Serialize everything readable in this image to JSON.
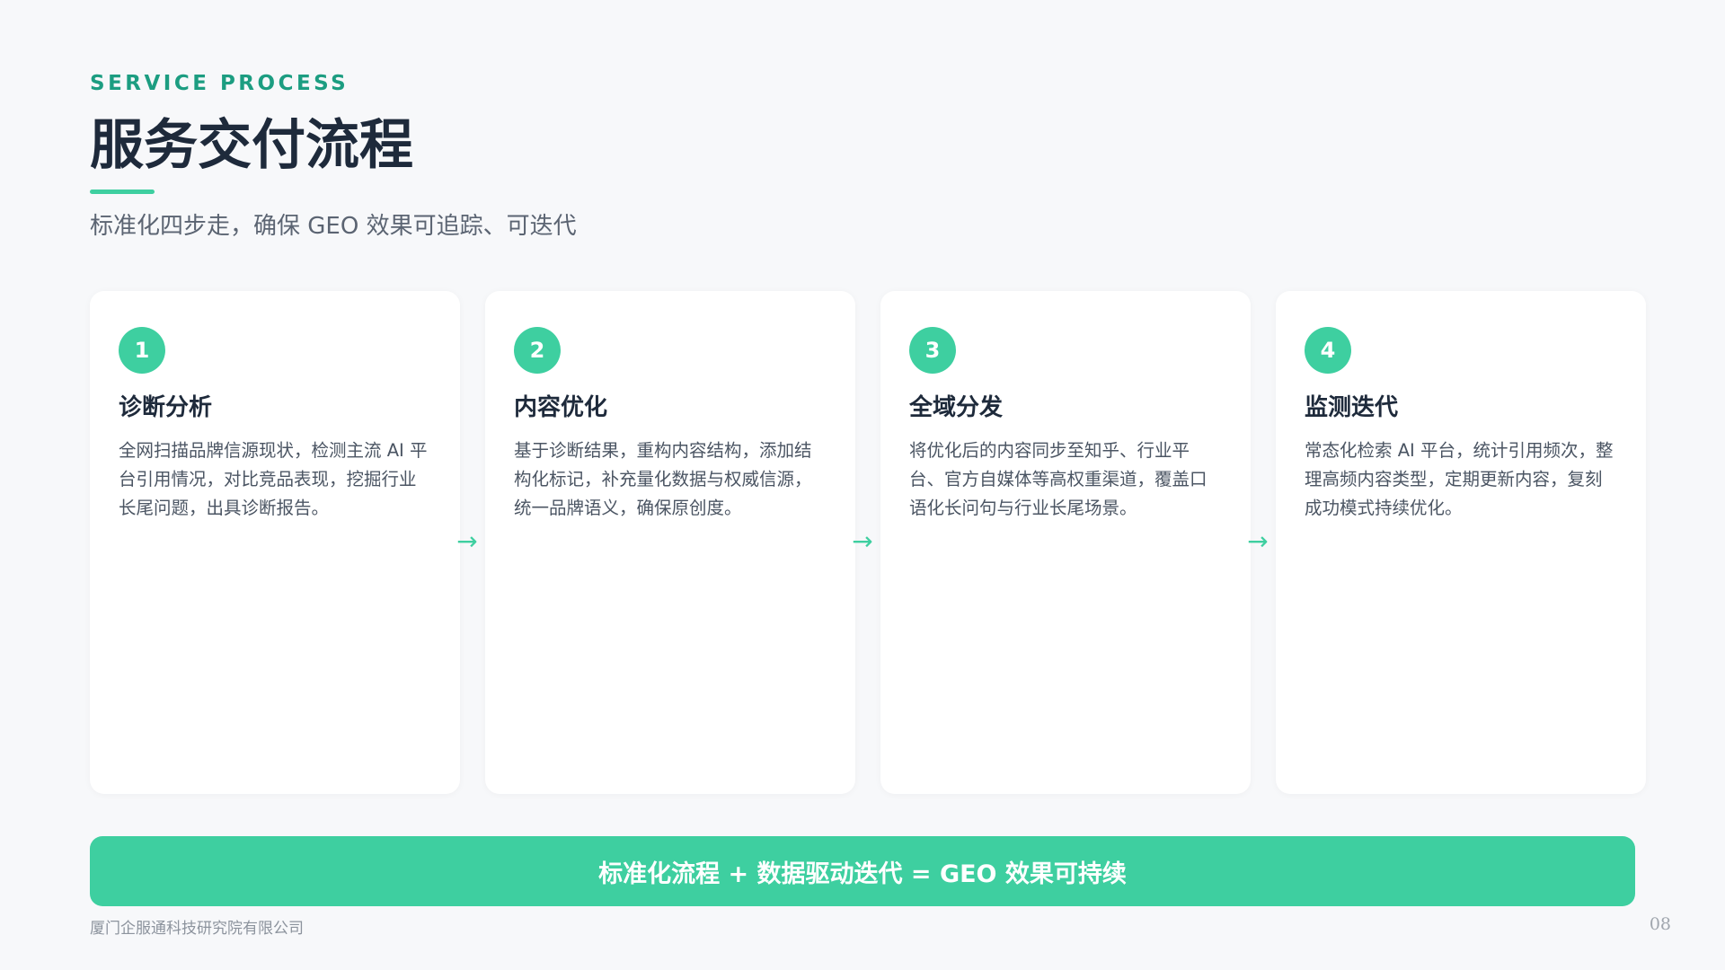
{
  "header": {
    "eyebrow": "SERVICE PROCESS",
    "title": "服务交付流程",
    "subtitle": "标准化四步走，确保 GEO 效果可追踪、可迭代"
  },
  "steps": [
    {
      "number": "1",
      "title": "诊断分析",
      "description": "全网扫描品牌信源现状，检测主流 AI 平台引用情况，对比竞品表现，挖掘行业长尾问题，出具诊断报告。"
    },
    {
      "number": "2",
      "title": "内容优化",
      "description": "基于诊断结果，重构内容结构，添加结构化标记，补充量化数据与权威信源，统一品牌语义，确保原创度。"
    },
    {
      "number": "3",
      "title": "全域分发",
      "description": "将优化后的内容同步至知乎、行业平台、官方自媒体等高权重渠道，覆盖口语化长问句与行业长尾场景。"
    },
    {
      "number": "4",
      "title": "监测迭代",
      "description": "常态化检索 AI 平台，统计引用频次，整理高频内容类型，定期更新内容，复刻成功模式持续优化。"
    }
  ],
  "arrows": [
    "→",
    "→",
    "→"
  ],
  "banner": {
    "text": "标准化流程 + 数据驱动迭代 = GEO 效果可持续"
  },
  "footer": {
    "company": "厦门企服通科技研究院有限公司",
    "page_number": "08"
  },
  "colors": {
    "accent": "#3ecfa0",
    "eyebrow": "#1c9d81",
    "title": "#1e2a3b",
    "background": "#f7f8fa"
  }
}
